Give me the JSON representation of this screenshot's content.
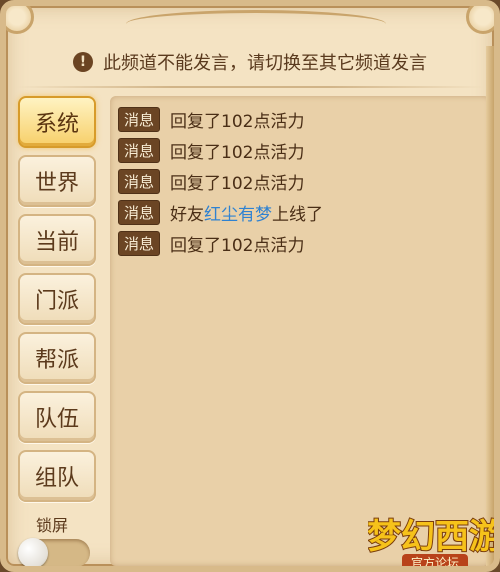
{
  "notice": {
    "icon": "exclamation-icon",
    "text": "此频道不能发言，请切换至其它频道发言"
  },
  "channels": [
    {
      "label": "系统",
      "active": true
    },
    {
      "label": "世界",
      "active": false
    },
    {
      "label": "当前",
      "active": false
    },
    {
      "label": "门派",
      "active": false
    },
    {
      "label": "帮派",
      "active": false
    },
    {
      "label": "队伍",
      "active": false
    },
    {
      "label": "组队",
      "active": false
    }
  ],
  "lock": {
    "label": "锁屏",
    "on": false
  },
  "messages": [
    {
      "tag": "消息",
      "text": "回复了102点活力"
    },
    {
      "tag": "消息",
      "text": "回复了102点活力"
    },
    {
      "tag": "消息",
      "text": "回复了102点活力"
    },
    {
      "tag": "消息",
      "prefix": "好友",
      "link": "红尘有梦",
      "suffix": "上线了"
    },
    {
      "tag": "消息",
      "text": "回复了102点活力"
    }
  ],
  "logo": {
    "main": "梦幻西游",
    "sub": "官方论坛"
  },
  "colors": {
    "panel_bg": "#f4e3c3",
    "message_bg": "#e9d0a8",
    "tag_bg": "#6b4524",
    "link": "#2f82d1",
    "active_channel": "#f7cf69"
  }
}
